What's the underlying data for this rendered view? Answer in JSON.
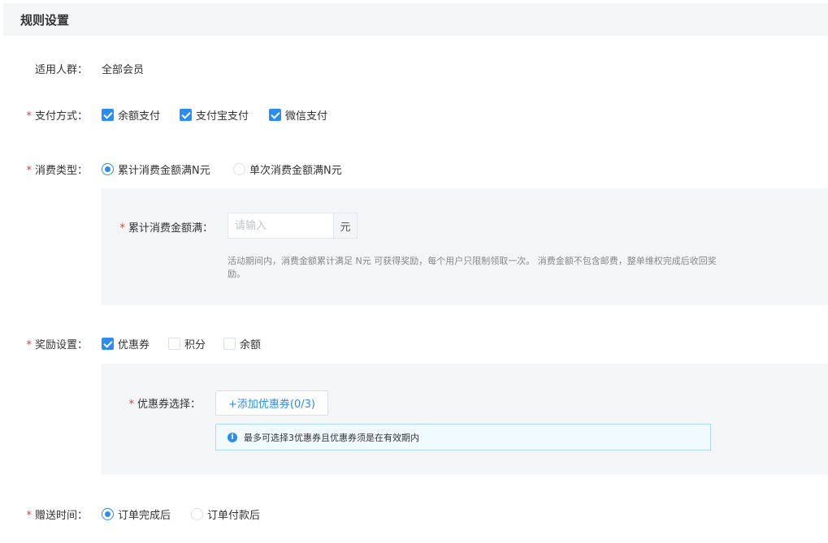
{
  "section": {
    "title": "规则设置"
  },
  "audience": {
    "label": "适用人群：",
    "value": "全部会员"
  },
  "payment": {
    "label": "支付方式：",
    "options": [
      {
        "label": "余额支付",
        "checked": true
      },
      {
        "label": "支付宝支付",
        "checked": true
      },
      {
        "label": "微信支付",
        "checked": true
      }
    ]
  },
  "consume_type": {
    "label": "消费类型：",
    "options": [
      {
        "label": "累计消费金额满N元",
        "selected": true
      },
      {
        "label": "单次消费金额满N元",
        "selected": false
      }
    ]
  },
  "threshold": {
    "label": "累计消费金额满：",
    "placeholder": "请输入",
    "value": "",
    "unit": "元",
    "hint": "活动期间内，消费金额累计满足 N元 可获得奖励，每个用户只限制领取一次。 消费金额不包含邮费，整单维权完成后收回奖励。"
  },
  "reward": {
    "label": "奖励设置：",
    "options": [
      {
        "label": "优惠券",
        "checked": true
      },
      {
        "label": "积分",
        "checked": false
      },
      {
        "label": "余额",
        "checked": false
      }
    ]
  },
  "coupon": {
    "label": "优惠券选择：",
    "add_button": "+添加优惠券(0/3)",
    "info": "最多可选择3优惠券且优惠券须是在有效期内"
  },
  "gift_time": {
    "label": "赠送时间：",
    "options": [
      {
        "label": "订单完成后",
        "selected": true
      },
      {
        "label": "订单付款后",
        "selected": false
      }
    ]
  },
  "required_mark": "*",
  "colors": {
    "accent": "#2d8cf0",
    "required": "#e4393c",
    "panel_bg": "#f4f5f7",
    "info_border": "#abdcff",
    "info_bg": "#f0faff"
  }
}
